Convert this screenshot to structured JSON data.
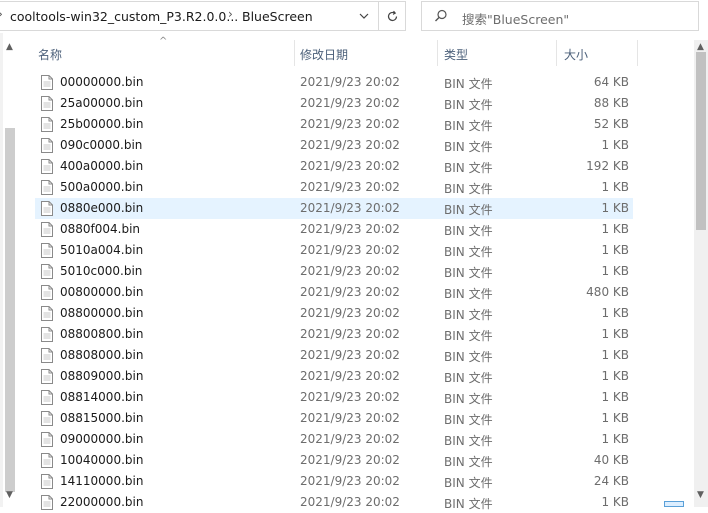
{
  "address": {
    "path_segments": [
      "cooltools-win32_custom_P3.R2.0.0...",
      "BlueScreen"
    ]
  },
  "search": {
    "placeholder": "搜索\"BlueScreen\""
  },
  "columns": {
    "name": "名称",
    "date": "修改日期",
    "type": "类型",
    "size": "大小"
  },
  "files": [
    {
      "name": "00000000.bin",
      "date": "2021/9/23 20:02",
      "type": "BIN 文件",
      "size": "64 KB"
    },
    {
      "name": "25a00000.bin",
      "date": "2021/9/23 20:02",
      "type": "BIN 文件",
      "size": "88 KB"
    },
    {
      "name": "25b00000.bin",
      "date": "2021/9/23 20:02",
      "type": "BIN 文件",
      "size": "52 KB"
    },
    {
      "name": "090c0000.bin",
      "date": "2021/9/23 20:02",
      "type": "BIN 文件",
      "size": "1 KB"
    },
    {
      "name": "400a0000.bin",
      "date": "2021/9/23 20:02",
      "type": "BIN 文件",
      "size": "192 KB"
    },
    {
      "name": "500a0000.bin",
      "date": "2021/9/23 20:02",
      "type": "BIN 文件",
      "size": "1 KB"
    },
    {
      "name": "0880e000.bin",
      "date": "2021/9/23 20:02",
      "type": "BIN 文件",
      "size": "1 KB",
      "selected": true
    },
    {
      "name": "0880f004.bin",
      "date": "2021/9/23 20:02",
      "type": "BIN 文件",
      "size": "1 KB"
    },
    {
      "name": "5010a004.bin",
      "date": "2021/9/23 20:02",
      "type": "BIN 文件",
      "size": "1 KB"
    },
    {
      "name": "5010c000.bin",
      "date": "2021/9/23 20:02",
      "type": "BIN 文件",
      "size": "1 KB"
    },
    {
      "name": "00800000.bin",
      "date": "2021/9/23 20:02",
      "type": "BIN 文件",
      "size": "480 KB"
    },
    {
      "name": "08800000.bin",
      "date": "2021/9/23 20:02",
      "type": "BIN 文件",
      "size": "1 KB"
    },
    {
      "name": "08800800.bin",
      "date": "2021/9/23 20:02",
      "type": "BIN 文件",
      "size": "1 KB"
    },
    {
      "name": "08808000.bin",
      "date": "2021/9/23 20:02",
      "type": "BIN 文件",
      "size": "1 KB"
    },
    {
      "name": "08809000.bin",
      "date": "2021/9/23 20:02",
      "type": "BIN 文件",
      "size": "1 KB"
    },
    {
      "name": "08814000.bin",
      "date": "2021/9/23 20:02",
      "type": "BIN 文件",
      "size": "1 KB"
    },
    {
      "name": "08815000.bin",
      "date": "2021/9/23 20:02",
      "type": "BIN 文件",
      "size": "1 KB"
    },
    {
      "name": "09000000.bin",
      "date": "2021/9/23 20:02",
      "type": "BIN 文件",
      "size": "1 KB"
    },
    {
      "name": "10040000.bin",
      "date": "2021/9/23 20:02",
      "type": "BIN 文件",
      "size": "40 KB"
    },
    {
      "name": "14110000.bin",
      "date": "2021/9/23 20:02",
      "type": "BIN 文件",
      "size": "24 KB"
    },
    {
      "name": "22000000.bin",
      "date": "2021/9/23 20:02",
      "type": "BIN 文件",
      "size": "1 KB"
    }
  ],
  "icons": {
    "file": "document-icon",
    "search": "search-icon",
    "refresh": "refresh-icon",
    "dropdown": "chevron-down-icon",
    "breadcrumb_separator": "chevron-right-icon",
    "sort": "sort-ascending-icon"
  },
  "colors": {
    "selection": "#e5f3ff",
    "header_text": "#4c607a",
    "secondary_text": "#6d6d6d"
  }
}
